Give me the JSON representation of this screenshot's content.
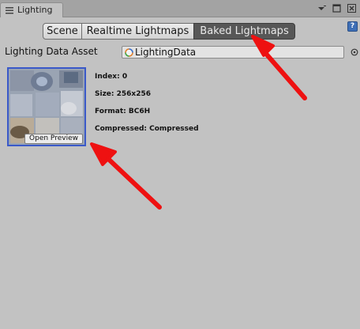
{
  "window": {
    "tab_title": "Lighting",
    "icons": [
      "lighting-tab-icon",
      "dropdown-menu-icon",
      "maximize-icon",
      "close-icon"
    ],
    "help_label": "?"
  },
  "mode_tabs": [
    {
      "label": "Scene",
      "active": false
    },
    {
      "label": "Realtime Lightmaps",
      "active": false
    },
    {
      "label": "Baked Lightmaps",
      "active": true
    }
  ],
  "lighting_data_asset": {
    "label": "Lighting Data Asset",
    "value": "LightingData"
  },
  "lightmap": {
    "open_preview_label": "Open Preview",
    "index_text": "Index: 0",
    "size_text": "Size: 256x256",
    "format_text": "Format: BC6H",
    "compressed_text": "Compressed: Compressed"
  },
  "colors": {
    "background": "#c2c2c2",
    "selection_border": "#3a59c9",
    "active_tab": "#575757",
    "annotation_arrow": "#ee1111"
  }
}
